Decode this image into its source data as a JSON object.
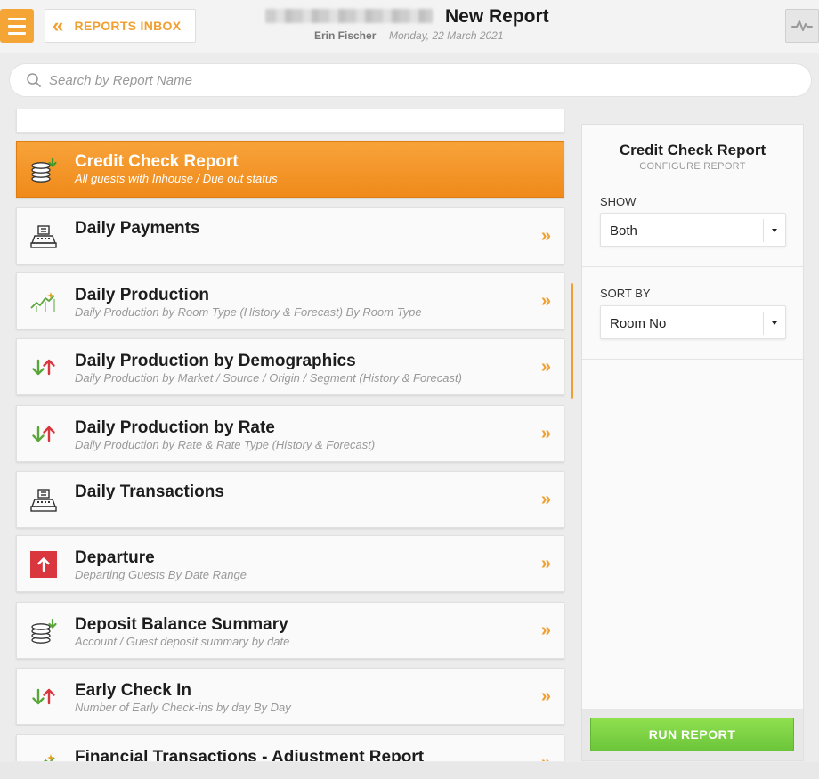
{
  "header": {
    "inbox_label": "REPORTS INBOX",
    "title": "New Report",
    "user": "Erin Fischer",
    "date": "Monday, 22 March 2021"
  },
  "search": {
    "placeholder": "Search by Report Name"
  },
  "reports": [
    {
      "name": "Credit Check Report",
      "desc": "All guests with Inhouse / Due out status",
      "icon": "coin-stack-icon"
    },
    {
      "name": "Daily Payments",
      "desc": "",
      "icon": "cash-register-icon"
    },
    {
      "name": "Daily Production",
      "desc": "Daily Production by Room Type (History & Forecast) By Room Type",
      "icon": "trend-chart-icon"
    },
    {
      "name": "Daily Production by Demographics",
      "desc": "Daily Production by Market / Source / Origin / Segment (History & Forecast)",
      "icon": "up-down-arrows-icon"
    },
    {
      "name": "Daily Production by Rate",
      "desc": "Daily Production by Rate & Rate Type (History & Forecast)",
      "icon": "up-down-arrows-icon"
    },
    {
      "name": "Daily Transactions",
      "desc": "",
      "icon": "cash-register-icon"
    },
    {
      "name": "Departure",
      "desc": "Departing Guests By Date Range",
      "icon": "departure-arrow-icon"
    },
    {
      "name": "Deposit Balance Summary",
      "desc": "Account / Guest deposit summary by date",
      "icon": "coin-stack-icon"
    },
    {
      "name": "Early Check In",
      "desc": "Number of Early Check-ins by day By Day",
      "icon": "up-down-arrows-icon"
    },
    {
      "name": "Financial Transactions - Adjustment Report",
      "desc": "",
      "icon": "trend-chart-icon"
    }
  ],
  "panel": {
    "title": "Credit Check Report",
    "subtitle": "CONFIGURE REPORT",
    "show_label": "SHOW",
    "show_value": "Both",
    "sort_label": "SORT BY",
    "sort_value": "Room No",
    "run_label": "RUN REPORT"
  },
  "colors": {
    "accent": "#f0a030",
    "run": "#78cf42",
    "up": "#d9363e",
    "down": "#5aa63a"
  }
}
